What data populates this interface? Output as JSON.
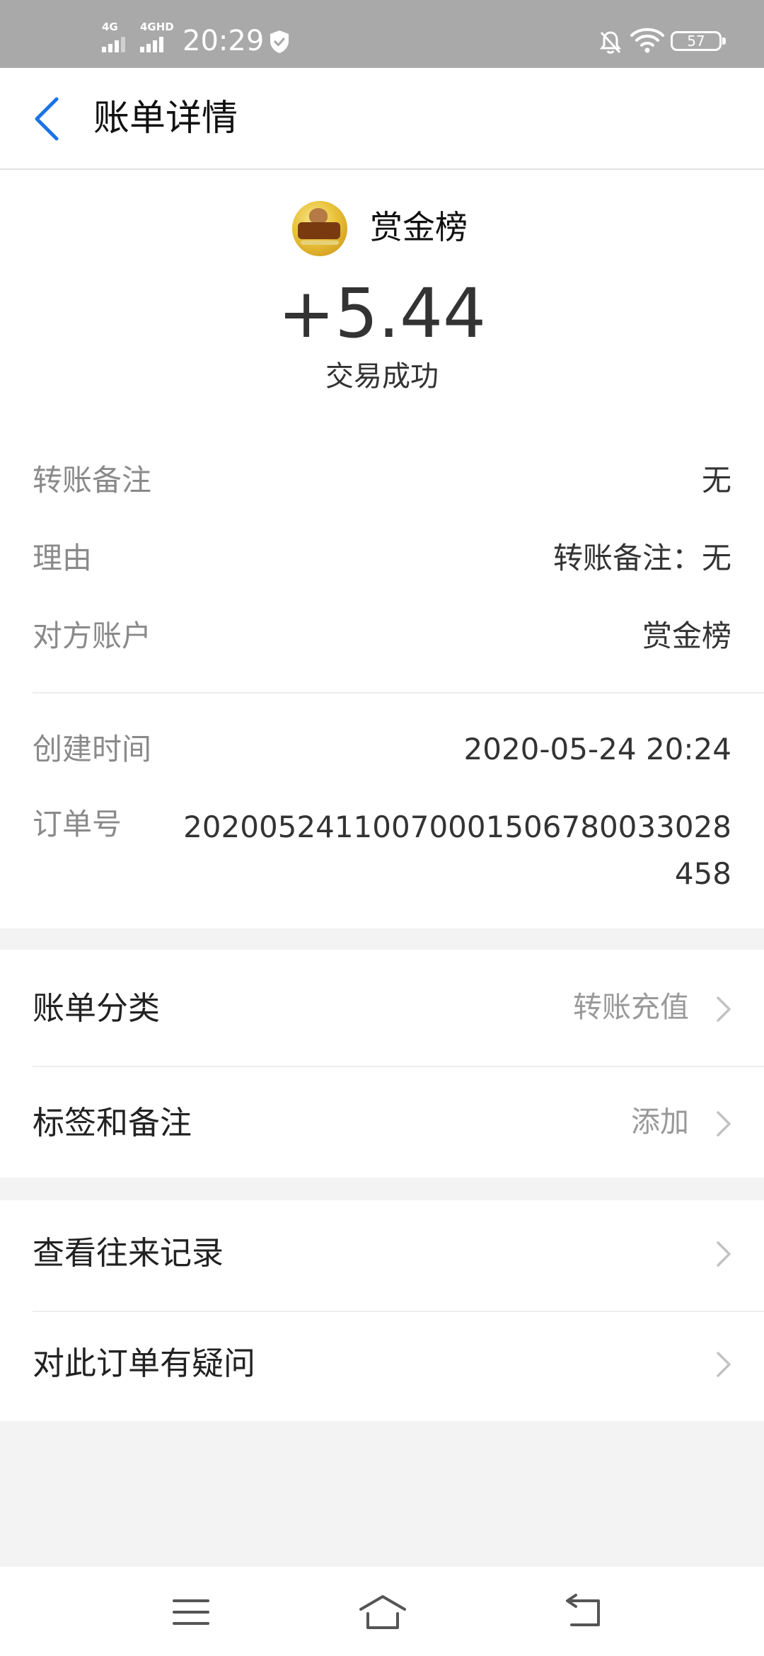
{
  "status_bar": {
    "network_1": "4G",
    "network_2": "4GHD",
    "time": "20:29",
    "battery": "57",
    "icons": [
      "signal-icon",
      "shield-icon",
      "bell-off-icon",
      "wifi-icon",
      "battery-icon"
    ]
  },
  "header": {
    "title": "账单详情",
    "back_icon": "chevron-left-icon"
  },
  "summary": {
    "merchant_name": "赏金榜",
    "amount": "+5.44",
    "status": "交易成功"
  },
  "details": [
    {
      "label": "转账备注",
      "value": "无"
    },
    {
      "label": "理由",
      "value": "转账备注：无"
    },
    {
      "label": "对方账户",
      "value": "赏金榜"
    },
    {
      "label": "创建时间",
      "value": "2020-05-24 20:24"
    },
    {
      "label": "订单号",
      "value": "20200524110070001506780033028458"
    }
  ],
  "menu_group_1": [
    {
      "label": "账单分类",
      "value": "转账充值"
    },
    {
      "label": "标签和备注",
      "value": "添加"
    }
  ],
  "menu_group_2": [
    {
      "label": "查看往来记录"
    },
    {
      "label": "对此订单有疑问"
    }
  ],
  "colors": {
    "accent": "#1a73e8",
    "status_bar": "#a9a9a9",
    "page_bg": "#f3f3f3",
    "label_gray": "#8a8a8a"
  },
  "nav_icons": [
    "menu-icon",
    "home-icon",
    "back-icon"
  ]
}
